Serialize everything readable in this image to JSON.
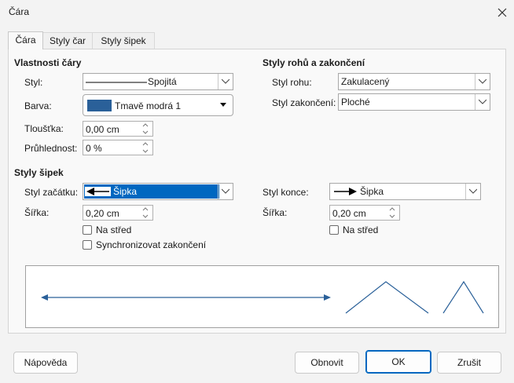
{
  "window": {
    "title": "Čára"
  },
  "tabs": [
    {
      "label": "Čára",
      "active": true
    },
    {
      "label": "Styly čar",
      "active": false
    },
    {
      "label": "Styly šipek",
      "active": false
    }
  ],
  "line_props": {
    "heading": "Vlastnosti čáry",
    "style_label": "Styl:",
    "style_value": "Spojitá",
    "color_label": "Barva:",
    "color_value": "Tmavě modrá 1",
    "color_hex": "#2a6099",
    "width_label": "Tloušťka:",
    "width_value": "0,00 cm",
    "transparency_label": "Průhlednost:",
    "transparency_value": "0 %"
  },
  "corner_props": {
    "heading": "Styly rohů a zakončení",
    "corner_label": "Styl rohu:",
    "corner_value": "Zakulacený",
    "cap_label": "Styl zakončení:",
    "cap_value": "Ploché"
  },
  "arrow_styles": {
    "heading": "Styly šipek",
    "start_label": "Styl začátku:",
    "start_value": "Šipka",
    "end_label": "Styl konce:",
    "end_value": "Šipka",
    "start_width_label": "Šířka:",
    "start_width_value": "0,20 cm",
    "end_width_label": "Šířka:",
    "end_width_value": "0,20 cm",
    "start_center_label": "Na střed",
    "end_center_label": "Na střed",
    "sync_label": "Synchronizovat zakončení"
  },
  "buttons": {
    "help": "Nápověda",
    "reset": "Obnovit",
    "ok": "OK",
    "cancel": "Zrušit"
  },
  "colors": {
    "accent": "#0067c0",
    "line": "#2a6099"
  }
}
